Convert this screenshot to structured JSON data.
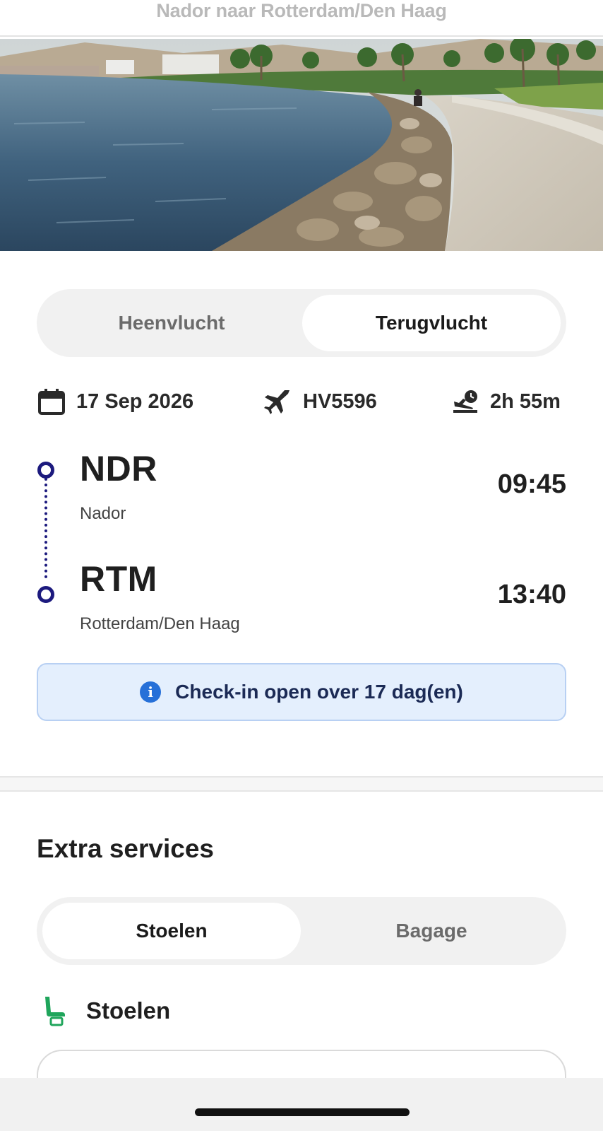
{
  "header": {
    "title": "Nador naar Rotterdam/Den Haag"
  },
  "flight_toggle": {
    "outbound_label": "Heenvlucht",
    "return_label": "Terugvlucht",
    "active": "return"
  },
  "flight_meta": {
    "date": "17 Sep 2026",
    "date_icon": "calendar-icon",
    "flight_number": "HV5596",
    "flight_icon": "plane-icon",
    "duration": "2h 55m",
    "duration_icon": "landing-clock-icon"
  },
  "route": {
    "origin": {
      "code": "NDR",
      "city": "Nador",
      "time": "09:45"
    },
    "destination": {
      "code": "RTM",
      "city": "Rotterdam/Den Haag",
      "time": "13:40"
    }
  },
  "checkin_notice": {
    "icon": "info-icon",
    "text": "Check-in open over 17 dag(en)"
  },
  "extra_services": {
    "title": "Extra services",
    "tabs": {
      "seats_label": "Stoelen",
      "baggage_label": "Bagage",
      "active": "seats"
    },
    "seats_heading": "Stoelen",
    "seats_icon": "seat-icon"
  },
  "colors": {
    "route_accent": "#1c1a7e",
    "info_bg": "#e4effd",
    "info_icon": "#2670d8",
    "seat_icon": "#1fa55b"
  }
}
